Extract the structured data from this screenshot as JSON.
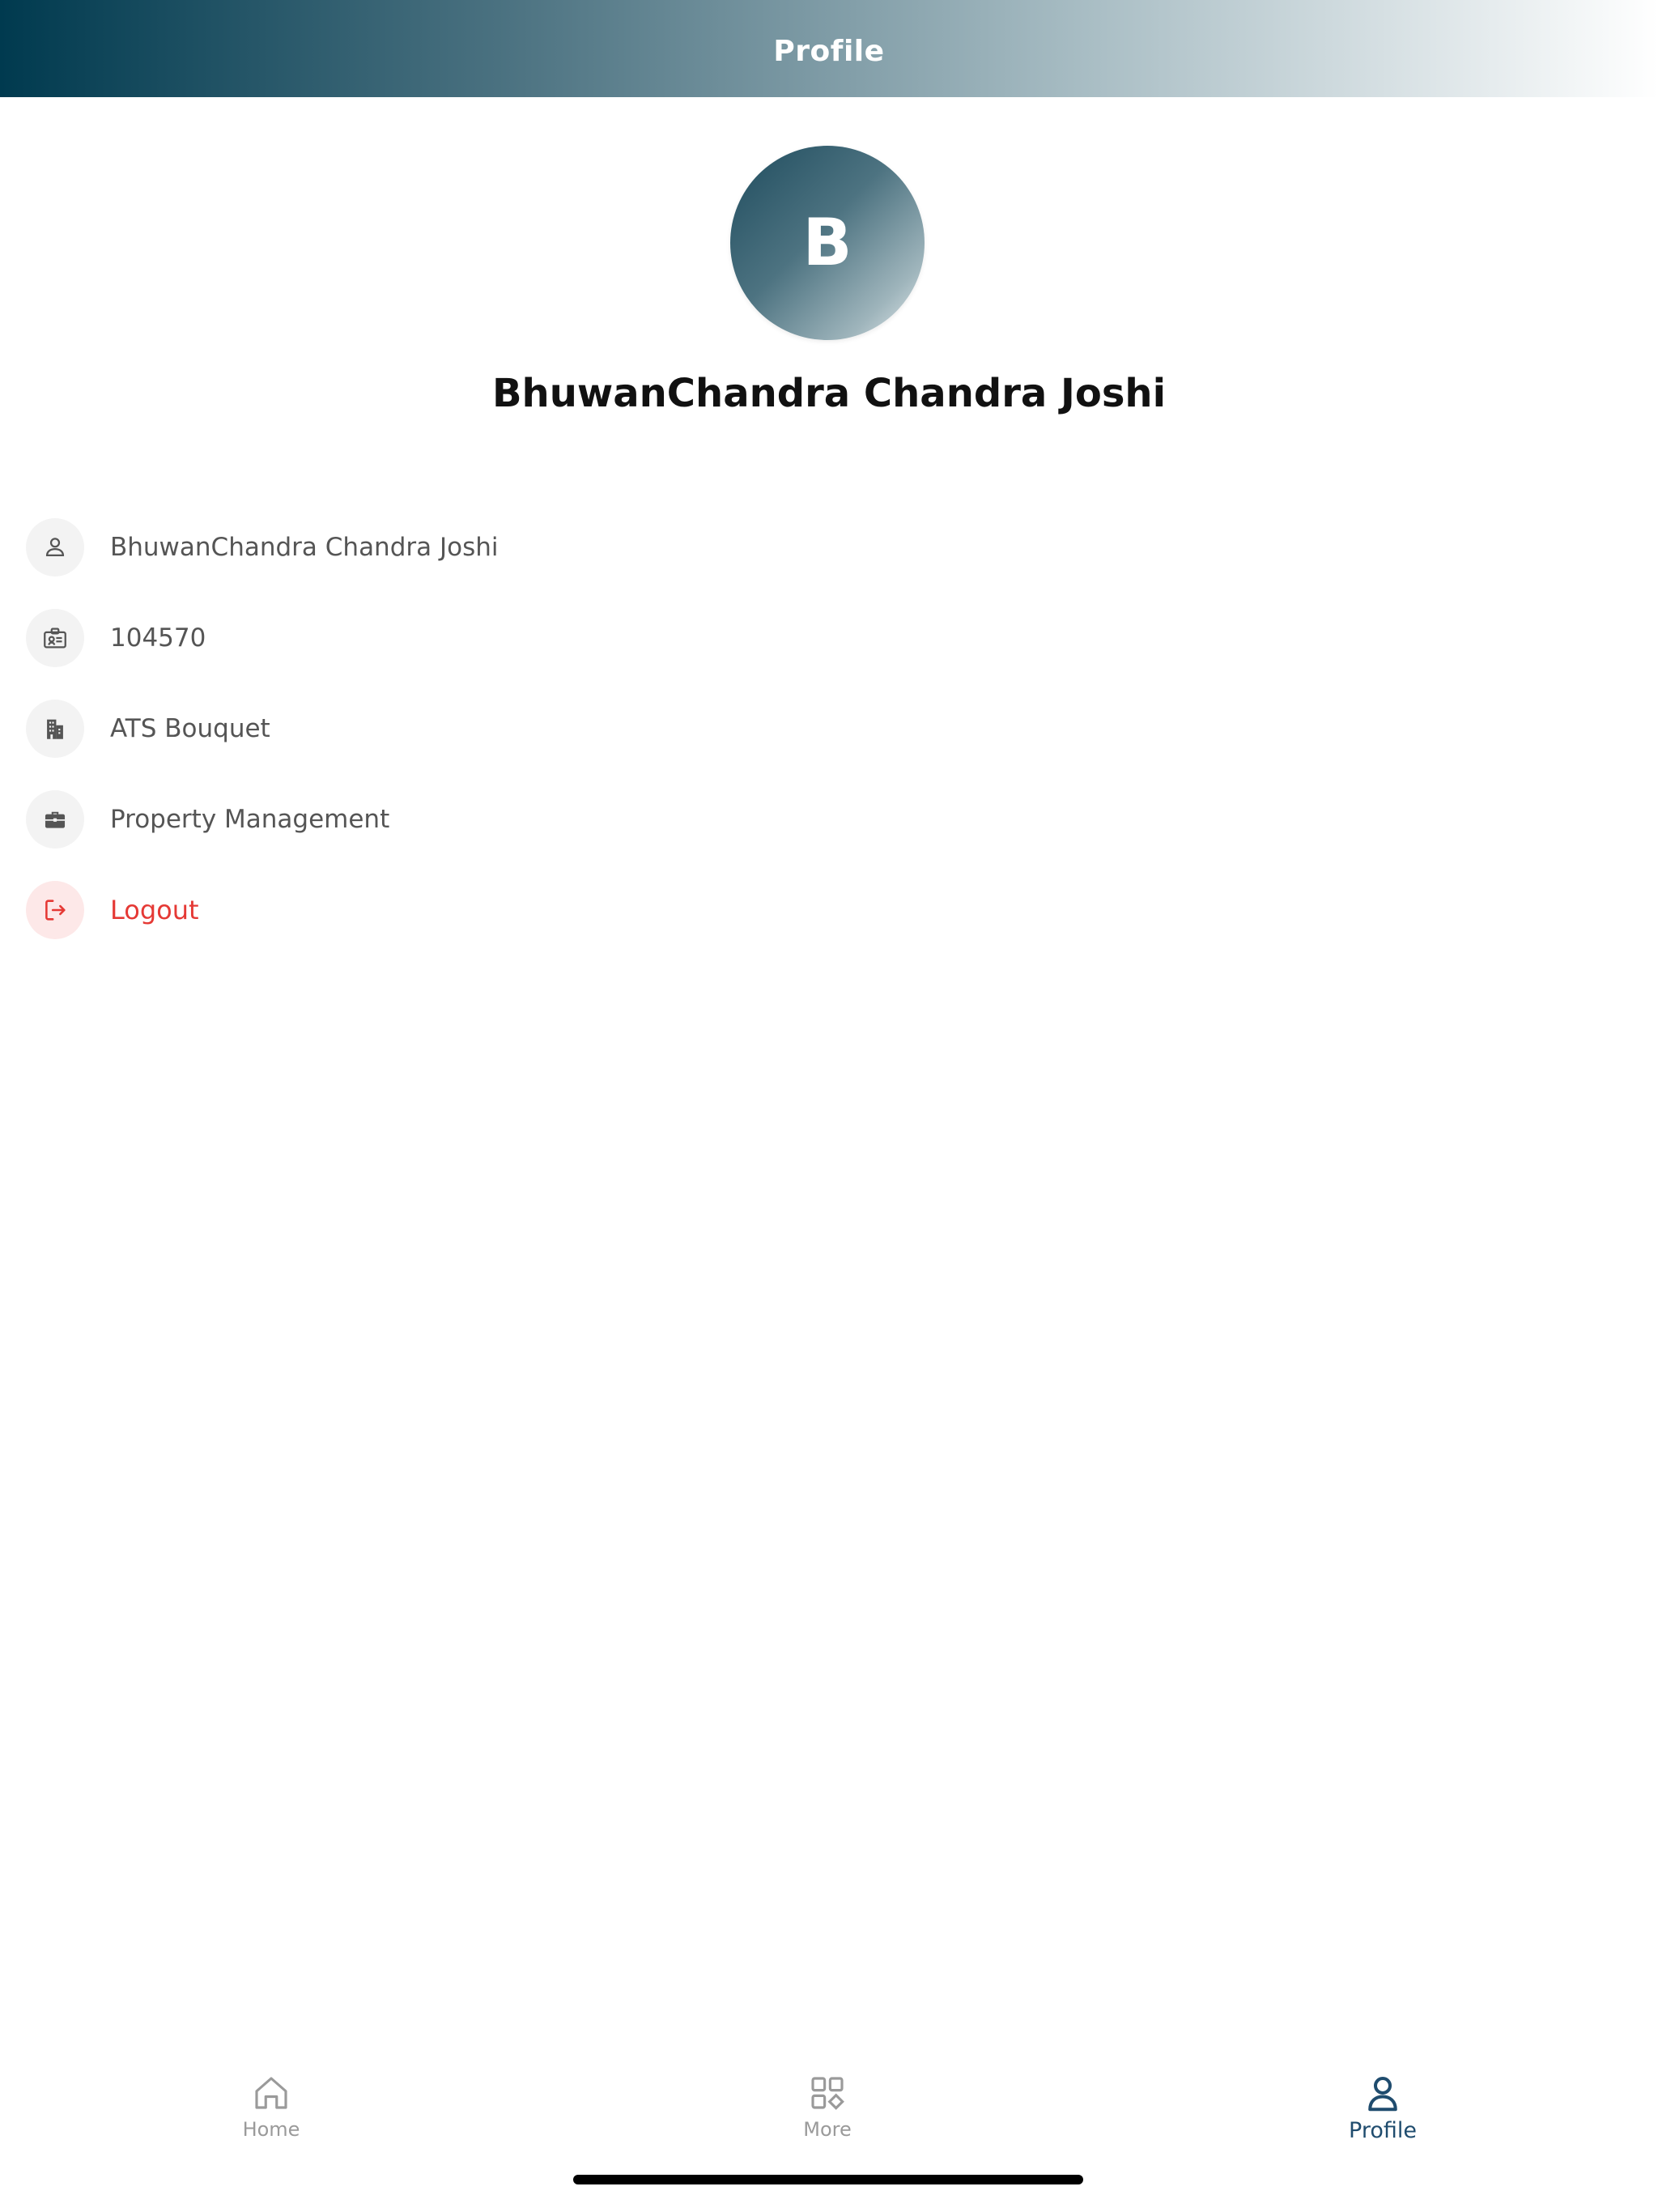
{
  "header": {
    "title": "Profile"
  },
  "profile": {
    "avatar_initial": "B",
    "name": "BhuwanChandra Chandra Joshi"
  },
  "info_items": [
    {
      "icon": "user-icon",
      "text": "BhuwanChandra Chandra Joshi"
    },
    {
      "icon": "id-card-icon",
      "text": "104570"
    },
    {
      "icon": "building-icon",
      "text": "ATS Bouquet"
    },
    {
      "icon": "briefcase-icon",
      "text": "Property Management"
    }
  ],
  "logout": {
    "icon": "logout-icon",
    "label": "Logout"
  },
  "bottom_nav": {
    "items": [
      {
        "icon": "home-icon",
        "label": "Home",
        "active": false
      },
      {
        "icon": "grid-icon",
        "label": "More",
        "active": false
      },
      {
        "icon": "profile-icon",
        "label": "Profile",
        "active": true
      }
    ]
  },
  "colors": {
    "accent": "#1f4c6e",
    "header_start": "#003a4f",
    "logout": "#e53935",
    "inactive": "#9a9a9a"
  }
}
